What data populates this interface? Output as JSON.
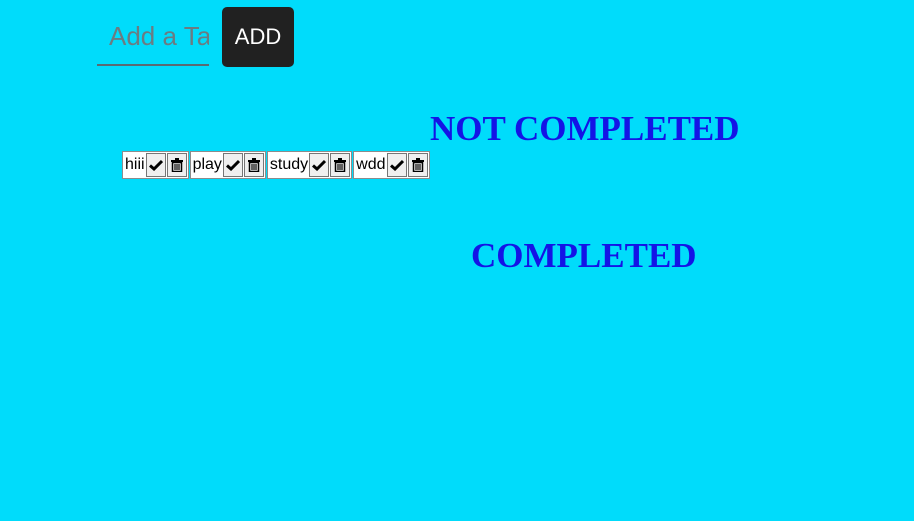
{
  "form": {
    "input_value": "",
    "input_placeholder": "Add a Task",
    "add_label": "ADD"
  },
  "tasks": [
    {
      "text": "hiii"
    },
    {
      "text": "play"
    },
    {
      "text": "study"
    },
    {
      "text": "wdd"
    }
  ],
  "task_icons": {
    "complete": "check-icon",
    "delete": "trash-icon"
  },
  "sections": {
    "not_completed": "NOT COMPLETED",
    "completed": "COMPLETED"
  },
  "colors": {
    "background": "#00dcfb",
    "heading": "#1414e6",
    "button": "#212121"
  }
}
